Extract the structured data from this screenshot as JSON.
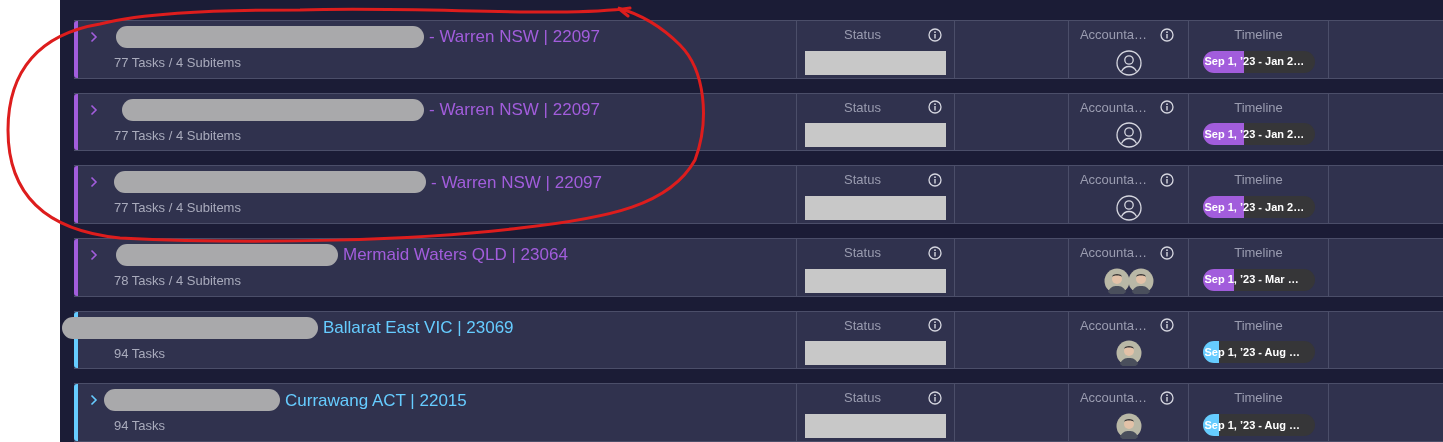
{
  "annotation": {
    "kind": "freehand-circle"
  },
  "groups": [
    {
      "title": "- Warren NSW | 22097",
      "color": "#a25ddc",
      "summary": "77 Tasks / 4 Subitems",
      "chevron": true,
      "redacted": true,
      "status_header": "Status",
      "accountant_header": "Accounta…",
      "timeline_header": "Timeline",
      "accountants": [
        {
          "kind": "empty"
        }
      ],
      "timeline": {
        "text": "Sep 1, ’23 - Jan 2…",
        "level": 0.37
      }
    },
    {
      "title": "- Warren NSW | 22097",
      "color": "#a25ddc",
      "summary": "77 Tasks / 4 Subitems",
      "chevron": true,
      "redacted": true,
      "status_header": "Status",
      "accountant_header": "Accounta…",
      "timeline_header": "Timeline",
      "accountants": [
        {
          "kind": "empty"
        }
      ],
      "timeline": {
        "text": "Sep 1, ’23 - Jan 2…",
        "level": 0.37
      }
    },
    {
      "title": "- Warren NSW | 22097",
      "color": "#a25ddc",
      "summary": "77 Tasks / 4 Subitems",
      "chevron": true,
      "redacted": true,
      "status_header": "Status",
      "accountant_header": "Accounta…",
      "timeline_header": "Timeline",
      "accountants": [
        {
          "kind": "empty"
        }
      ],
      "timeline": {
        "text": "Sep 1, ’23 - Jan 2…",
        "level": 0.37
      }
    },
    {
      "title": "Mermaid Waters QLD | 23064",
      "color": "#a25ddc",
      "summary": "78 Tasks / 4 Subitems",
      "chevron": true,
      "redacted": true,
      "status_header": "Status",
      "accountant_header": "Accounta…",
      "timeline_header": "Timeline",
      "accountants": [
        {
          "kind": "photo"
        },
        {
          "kind": "photo"
        }
      ],
      "timeline": {
        "text": "Sep 1, ’23 - Mar …",
        "level": 0.28
      }
    },
    {
      "title": "Ballarat East VIC | 23069",
      "color": "#66ccff",
      "summary": "94 Tasks",
      "chevron": false,
      "redacted": true,
      "status_header": "Status",
      "accountant_header": "Accounta…",
      "timeline_header": "Timeline",
      "accountants": [
        {
          "kind": "photo"
        }
      ],
      "timeline": {
        "text": "Sep 1, ’23 - Aug …",
        "level": 0.15
      }
    },
    {
      "title": "Currawang ACT | 22015",
      "color": "#66ccff",
      "summary": "94 Tasks",
      "chevron": true,
      "redacted": true,
      "status_header": "Status",
      "accountant_header": "Accounta…",
      "timeline_header": "Timeline",
      "accountants": [
        {
          "kind": "photo"
        }
      ],
      "timeline": {
        "text": "Sep 1, ’23 - Aug …",
        "level": 0.15
      }
    }
  ]
}
